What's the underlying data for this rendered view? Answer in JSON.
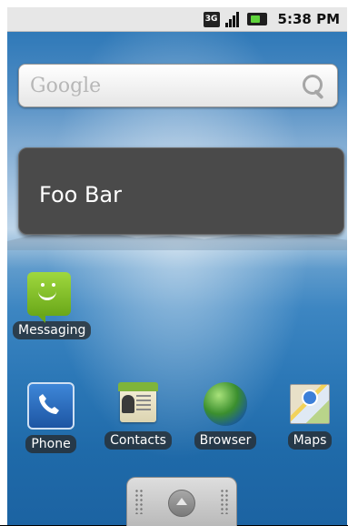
{
  "status_bar": {
    "network": "3G",
    "time": "5:38 PM"
  },
  "search_widget": {
    "placeholder": "Google"
  },
  "widget": {
    "text": "Foo Bar"
  },
  "shortcuts": [
    {
      "label": "Messaging",
      "icon": "messaging-icon"
    }
  ],
  "dock": [
    {
      "label": "Phone",
      "icon": "phone-icon"
    },
    {
      "label": "Contacts",
      "icon": "contacts-icon"
    },
    {
      "label": "Browser",
      "icon": "browser-icon"
    },
    {
      "label": "Maps",
      "icon": "maps-icon"
    }
  ],
  "colors": {
    "widget_bg": "#4a4a4a",
    "status_bar_bg": "#e7e7e7",
    "wallpaper_top": "#2f79b8",
    "wallpaper_bottom": "#1c63a2"
  }
}
